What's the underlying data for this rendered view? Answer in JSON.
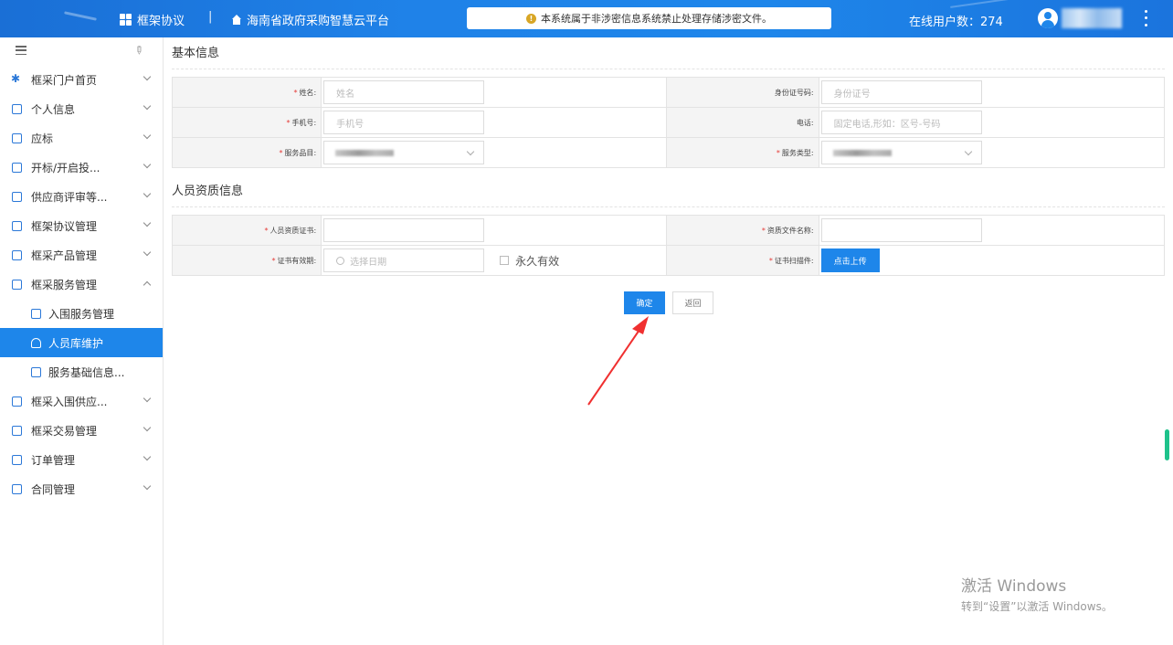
{
  "header": {
    "brand": "框架协议",
    "separator": "|",
    "platform": "海南省政府采购智慧云平台",
    "notice": "本系统属于非涉密信息系统禁止处理存储涉密文件。",
    "online_users": "在线用户数：274",
    "accent_color": "#1e86ea"
  },
  "sidebar": {
    "items": [
      {
        "label": "框采门户首页",
        "icon": "flower-icon"
      },
      {
        "label": "个人信息",
        "icon": "id-card-icon"
      },
      {
        "label": "应标",
        "icon": "doc-icon"
      },
      {
        "label": "开标/开启投...",
        "icon": "doc-icon"
      },
      {
        "label": "供应商评审等...",
        "icon": "monitor-icon"
      },
      {
        "label": "框架协议管理",
        "icon": "doc-icon"
      },
      {
        "label": "框采产品管理",
        "icon": "doc-icon"
      },
      {
        "label": "框采服务管理",
        "icon": "service-icon"
      },
      {
        "label": "入围服务管理",
        "icon": "service-icon"
      },
      {
        "label": "人员库维护",
        "icon": "person-icon"
      },
      {
        "label": "服务基础信息...",
        "icon": "doc-icon"
      },
      {
        "label": "框采入围供应...",
        "icon": "doc-icon"
      },
      {
        "label": "框采交易管理",
        "icon": "doc-icon"
      },
      {
        "label": "订单管理",
        "icon": "doc-icon"
      },
      {
        "label": "合同管理",
        "icon": "doc-icon"
      }
    ]
  },
  "basic": {
    "title": "基本信息",
    "name_label": "姓名",
    "name_placeholder": "姓名",
    "id_label": "身份证号码",
    "id_placeholder": "身份证号",
    "mobile_label": "手机号",
    "mobile_placeholder": "手机号",
    "phone_label": "电话",
    "phone_placeholder": "固定电话,形如：区号-号码",
    "category_label": "服务品目",
    "type_label": "服务类型"
  },
  "qual": {
    "title": "人员资质信息",
    "cert_label": "人员资质证书",
    "file_label": "资质文件名称",
    "valid_label": "证书有效期",
    "date_placeholder": "选择日期",
    "permanent_label": "永久有效",
    "scan_label": "证书扫描件",
    "upload_label": "点击上传"
  },
  "actions": {
    "confirm": "确定",
    "back": "返回"
  },
  "watermark": {
    "line1": "激活 Windows",
    "line2": "转到“设置”以激活 Windows。"
  }
}
